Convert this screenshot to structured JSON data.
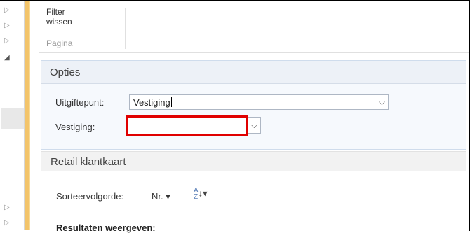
{
  "toolbar": {
    "filter_clear_label": "Filter\nwissen",
    "group_label": "Pagina"
  },
  "options": {
    "title": "Opties",
    "issue_point_label": "Uitgiftepunt:",
    "issue_point_value": "Vestiging",
    "branch_label": "Vestiging:",
    "branch_value": ""
  },
  "retail": {
    "title": "Retail klantkaart",
    "sort_label": "Sorteervolgorde:",
    "sort_value": "Nr.",
    "results_label": "Resultaten weergeven:"
  },
  "icons": {
    "left_nav": [
      "triangle-right-icon",
      "triangle-right-icon",
      "triangle-right-icon",
      "triangle-down-icon",
      "triangle-right-icon",
      "triangle-right-icon"
    ],
    "sort_order": "sort-az-icon",
    "dropdown": "chevron-down-icon"
  },
  "colors": {
    "accent_bar": "#f3c46a",
    "highlight_box": "#e00000",
    "panel_bg": "#f6f9fd"
  }
}
